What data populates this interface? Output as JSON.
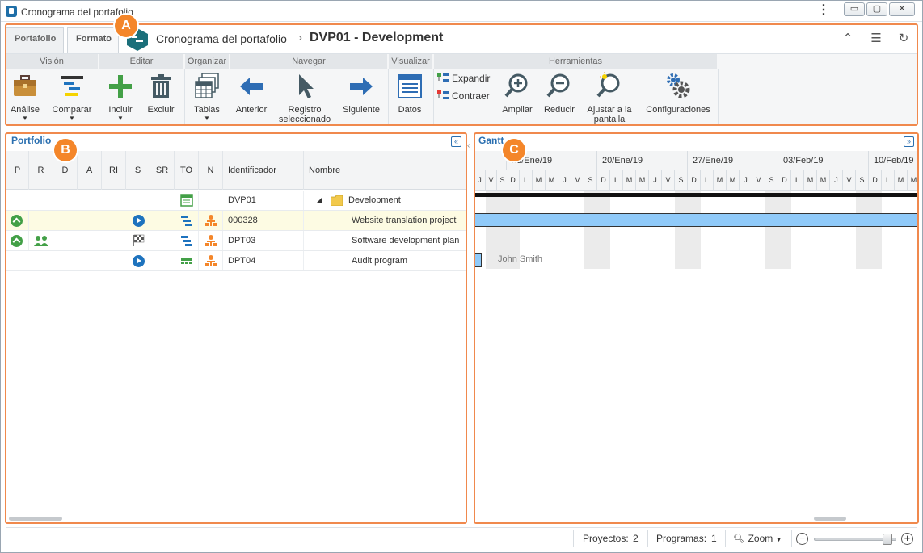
{
  "window": {
    "title": "Cronograma del portafolio"
  },
  "ribbon": {
    "tabs": [
      "Portafolio",
      "Formato"
    ],
    "breadcrumb": {
      "parent": "Cronograma del portafolio",
      "current": "DVP01 - Development"
    },
    "groups": {
      "vision": "Visión",
      "editar": "Editar",
      "organizar": "Organizar",
      "navegar": "Navegar",
      "visualizar": "Visualizar",
      "herramientas": "Herramientas"
    },
    "buttons": {
      "analise": "Análise",
      "comparar": "Comparar",
      "incluir": "Incluir",
      "excluir": "Excluir",
      "tablas": "Tablas",
      "anterior": "Anterior",
      "registro_1": "Registro",
      "registro_2": "seleccionado",
      "siguiente": "Siguiente",
      "datos": "Datos",
      "expandir": "Expandir",
      "contraer": "Contraer",
      "ampliar": "Ampliar",
      "reducir": "Reducir",
      "ajustar_1": "Ajustar a la",
      "ajustar_2": "pantalla",
      "configuraciones": "Configuraciones"
    }
  },
  "callouts": {
    "a": "A",
    "b": "B",
    "c": "C"
  },
  "portfolio": {
    "title": "Portfolio",
    "columns": [
      "P",
      "R",
      "D",
      "A",
      "RI",
      "S",
      "SR",
      "TO",
      "N",
      "Identificador",
      "Nombre"
    ],
    "rows": [
      {
        "id": "DVP01",
        "name": "Development"
      },
      {
        "id": "000328",
        "name": "Website translation project"
      },
      {
        "id": "DPT03",
        "name": "Software development plan"
      },
      {
        "id": "DPT04",
        "name": "Audit program"
      }
    ]
  },
  "gantt": {
    "title": "Gantt",
    "weeks": [
      "13/Ene/19",
      "20/Ene/19",
      "27/Ene/19",
      "03/Feb/19",
      "10/Feb/19"
    ],
    "week_days": [
      "D",
      "L",
      "M",
      "M",
      "J",
      "V",
      "S"
    ],
    "resource_label": "John Smith"
  },
  "status": {
    "proyectos_label": "Proyectos:",
    "proyectos_value": "2",
    "programas_label": "Programas:",
    "programas_value": "1",
    "zoom_label": "Zoom",
    "zoom_level": 0.93
  },
  "colors": {
    "accent": "#2a6fb0",
    "highlight": "#f0894d",
    "callout": "#f4862a",
    "gantt_bar": "#90caf9",
    "selected_row": "#fdfbe3"
  }
}
